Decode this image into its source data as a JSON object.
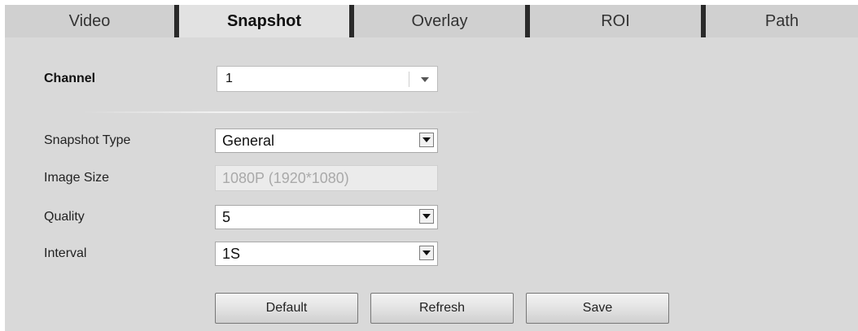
{
  "tabs": [
    {
      "label": "Video",
      "active": false
    },
    {
      "label": "Snapshot",
      "active": true
    },
    {
      "label": "Overlay",
      "active": false
    },
    {
      "label": "ROI",
      "active": false
    },
    {
      "label": "Path",
      "active": false
    }
  ],
  "form": {
    "channel": {
      "label": "Channel",
      "value": "1"
    },
    "snapshot_type": {
      "label": "Snapshot Type",
      "value": "General"
    },
    "image_size": {
      "label": "Image Size",
      "value": "1080P (1920*1080)"
    },
    "quality": {
      "label": "Quality",
      "value": "5"
    },
    "interval": {
      "label": "Interval",
      "value": "1S"
    }
  },
  "buttons": {
    "default": "Default",
    "refresh": "Refresh",
    "save": "Save"
  },
  "colors": {
    "tab_background": "#d0d0d0",
    "tab_active_background": "#e2e2e2",
    "tab_separator": "#2a2a2a",
    "panel_background": "#d9d9d9",
    "disabled_text": "#a9a9a9"
  },
  "icons": {
    "dropdown": "chevron-down-icon"
  }
}
